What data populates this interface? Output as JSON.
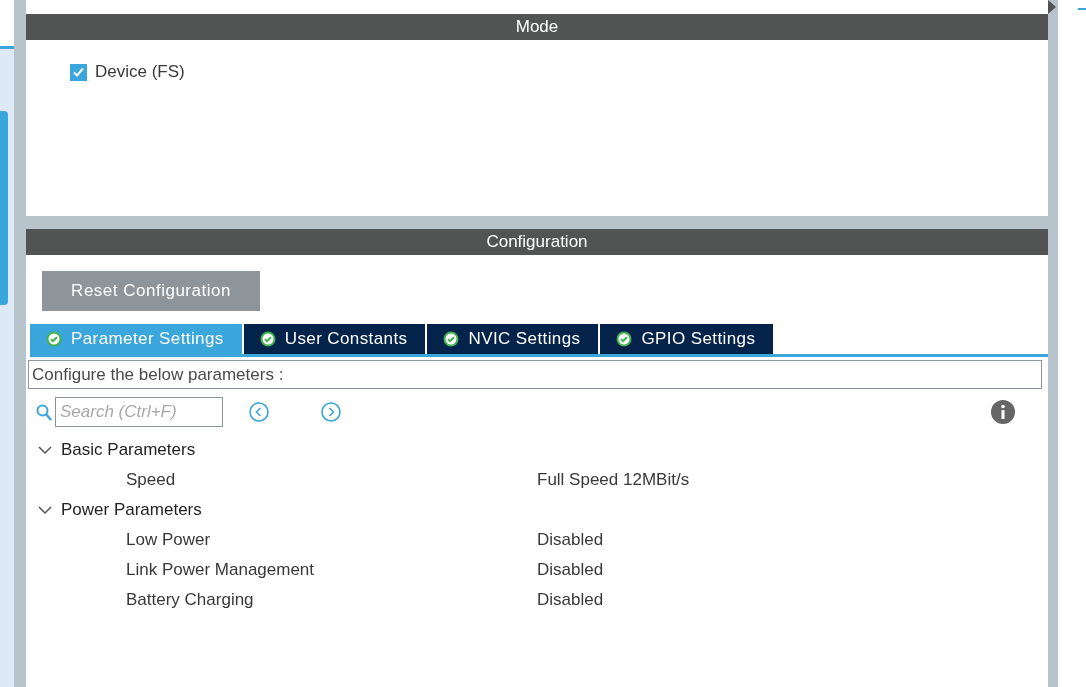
{
  "mode": {
    "title": "Mode",
    "options": [
      {
        "label": "Device (FS)",
        "checked": true
      }
    ]
  },
  "configuration": {
    "title": "Configuration",
    "reset_button": "Reset Configuration",
    "tabs": [
      {
        "label": "Parameter Settings",
        "selected": true
      },
      {
        "label": "User Constants",
        "selected": false
      },
      {
        "label": "NVIC Settings",
        "selected": false
      },
      {
        "label": "GPIO Settings",
        "selected": false
      }
    ],
    "description": "Configure the below parameters :",
    "search": {
      "placeholder": "Search (Ctrl+F)"
    },
    "groups": [
      {
        "label": "Basic Parameters",
        "expanded": true,
        "children": [
          {
            "name": "Speed",
            "value": "Full Speed 12MBit/s"
          }
        ]
      },
      {
        "label": "Power Parameters",
        "expanded": true,
        "children": [
          {
            "name": "Low Power",
            "value": "Disabled"
          },
          {
            "name": "Link Power Management",
            "value": "Disabled"
          },
          {
            "name": "Battery Charging",
            "value": "Disabled"
          }
        ]
      }
    ]
  }
}
